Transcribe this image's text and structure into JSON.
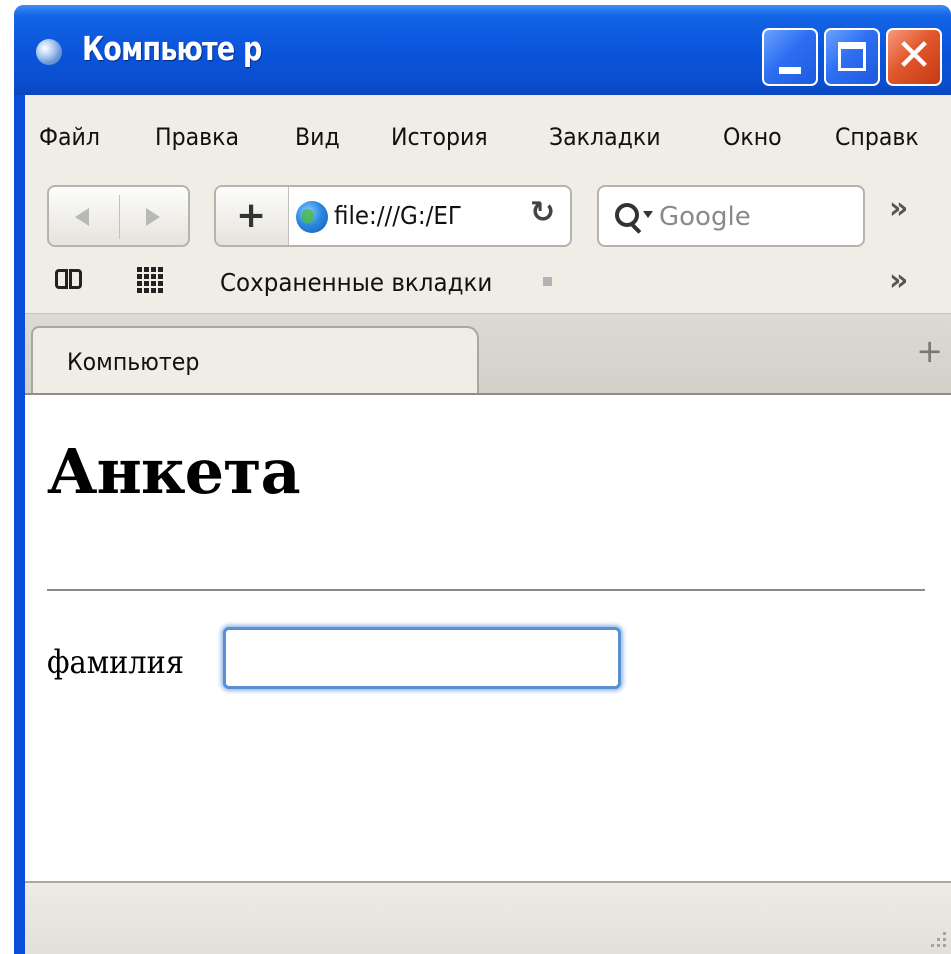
{
  "window": {
    "title": "Компьюте р"
  },
  "menubar": {
    "items": [
      "Файл",
      "Правка",
      "Вид",
      "История",
      "Закладки",
      "Окно",
      "Справк"
    ]
  },
  "toolbar": {
    "address": "file:///G:/EГ",
    "search_placeholder": "Google"
  },
  "bookmarks": {
    "label": "Сохраненные вкладки"
  },
  "tabs": {
    "active_label": "Компьютер"
  },
  "page": {
    "heading": "Анкета",
    "field_label": "фамилия",
    "field_value": ""
  },
  "colors": {
    "titlebar": "#0a55dc",
    "chrome": "#efede6",
    "focus_ring": "#5a8fd3",
    "close_button": "#e2572c"
  },
  "icons": [
    "globe-icon",
    "minimize-icon",
    "maximize-icon",
    "close-icon",
    "back-arrow-icon",
    "forward-arrow-icon",
    "plus-icon",
    "reload-icon",
    "search-icon",
    "chevron-double-right-icon",
    "book-icon",
    "grid-icon",
    "new-tab-plus-icon",
    "resize-grip-icon"
  ]
}
